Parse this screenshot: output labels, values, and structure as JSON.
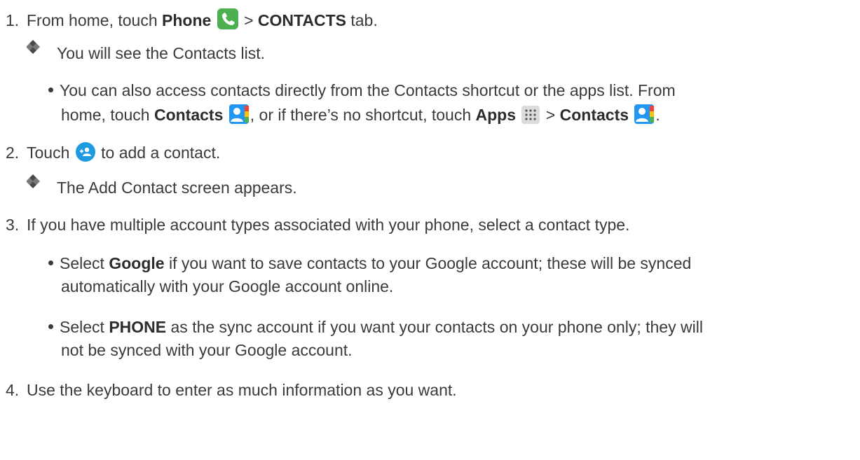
{
  "steps": [
    {
      "number": "1.",
      "pre": "From home, touch ",
      "bold1": "Phone",
      "sep": " > ",
      "bold2": "CONTACTS",
      "post": " tab.",
      "result": "You will see the Contacts list.",
      "note": {
        "line1": "You can also access contacts directly from the Contacts shortcut or the apps list. From",
        "line2_pre": "home, touch ",
        "line2_b1": "Contacts",
        "line2_mid": ", or if there’s no shortcut, touch ",
        "line2_b2": "Apps",
        "line2_sep": " > ",
        "line2_b3": "Contacts",
        "line2_end": "."
      }
    },
    {
      "number": "2.",
      "pre": "Touch ",
      "post": " to add a contact.",
      "result": "The Add Contact screen appears."
    },
    {
      "number": "3.",
      "text": "If you have multiple account types associated with your phone, select a contact type.",
      "bullets": [
        {
          "pre": "Select ",
          "bold": "Google",
          "line1": " if you want to save contacts to your Google account; these will be synced",
          "line2": "automatically with your Google account online."
        },
        {
          "pre": "Select ",
          "bold": "PHONE",
          "line1": " as the sync account if you want your contacts on your phone only; they will",
          "line2": "not be synced with your Google account."
        }
      ]
    },
    {
      "number": "4.",
      "text": "Use the keyboard to enter as much information as you want."
    }
  ],
  "icons": {
    "phone": "phone-app-icon",
    "contacts": "contacts-app-icon",
    "apps": "apps-launcher-icon",
    "add_contact": "add-contact-icon",
    "result_marker": "diamond-bullet-icon"
  }
}
